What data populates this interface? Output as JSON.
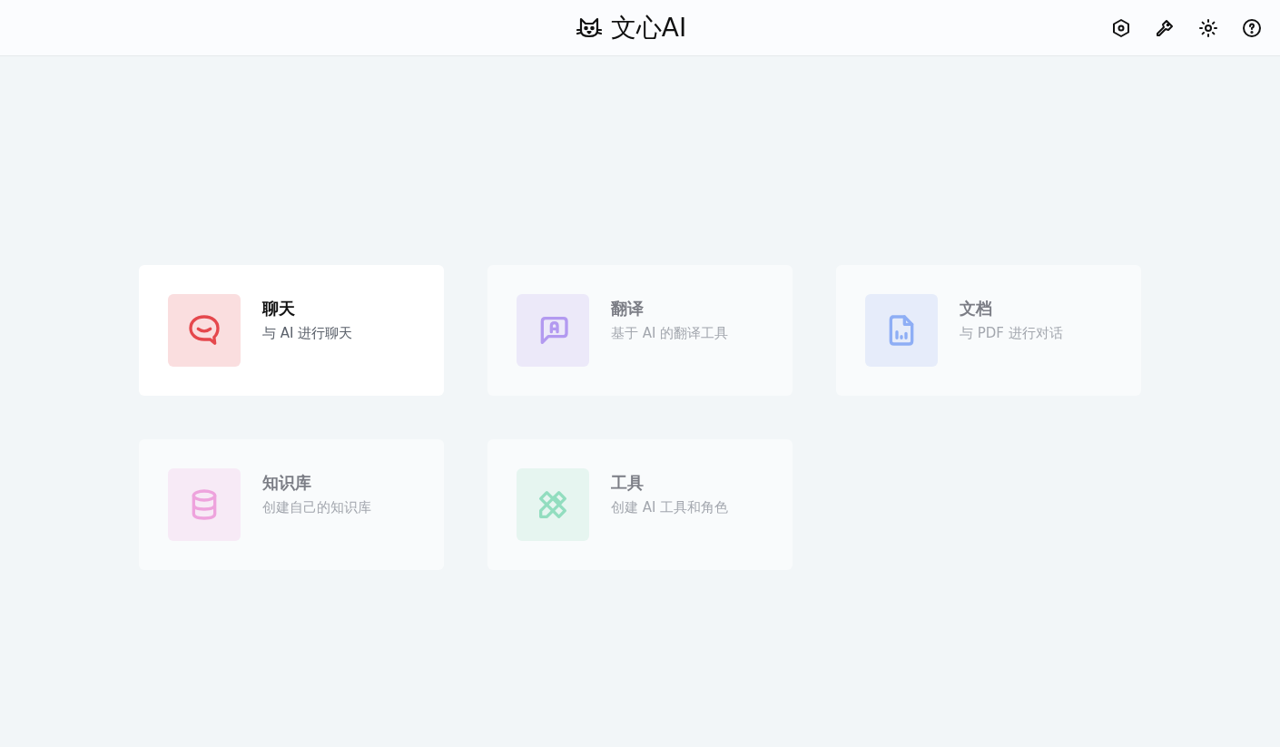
{
  "header": {
    "title": "文心AI"
  },
  "cards": [
    {
      "kind": "chat",
      "title": "聊天",
      "subtitle": "与 AI 进行聊天",
      "selected": true,
      "color": "#e5484d"
    },
    {
      "kind": "translate",
      "title": "翻译",
      "subtitle": "基于 AI 的翻译工具",
      "selected": false,
      "color": "#b39af0"
    },
    {
      "kind": "document",
      "title": "文档",
      "subtitle": "与 PDF 进行对话",
      "selected": false,
      "color": "#8eaef5"
    },
    {
      "kind": "database",
      "title": "知识库",
      "subtitle": "创建自己的知识库",
      "selected": false,
      "color": "#eea3dd"
    },
    {
      "kind": "tools",
      "title": "工具",
      "subtitle": "创建 AI 工具和角色",
      "selected": false,
      "color": "#92ddbf"
    }
  ]
}
